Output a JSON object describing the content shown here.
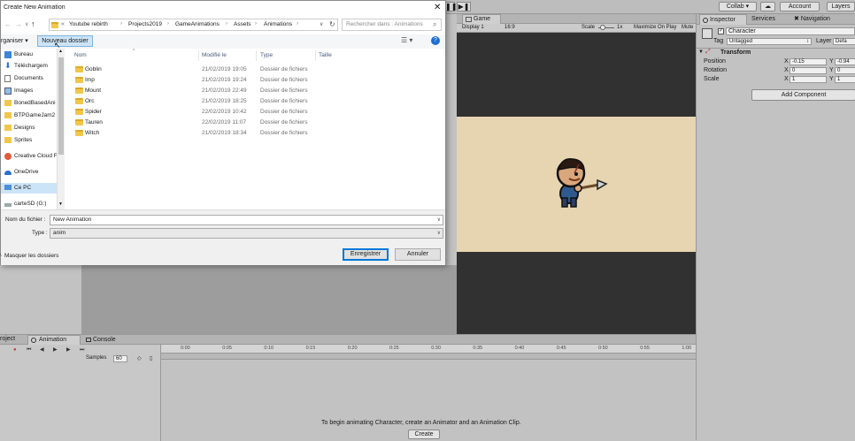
{
  "topbar": {
    "collab": "Collab ▾",
    "account": "Account",
    "layers": "Layers"
  },
  "game": {
    "tab": "Game",
    "display": "Display 1",
    "aspect": "16:9",
    "scale_label": "Scale",
    "scale_value": "1x",
    "maximize": "Maximize On Play",
    "mute": "Mute"
  },
  "inspector": {
    "tabs": [
      "Inspector",
      "Services",
      "Navigation"
    ],
    "object_name": "Character",
    "tag_label": "Tag",
    "tag_value": "Untagged",
    "layer_label": "Layer",
    "layer_value": "Defa",
    "component": "Transform",
    "position_label": "Position",
    "rotation_label": "Rotation",
    "scale_label": "Scale",
    "x_label": "X",
    "y_label": "Y",
    "pos_x": "-0.15",
    "pos_y": "-0.94",
    "rot_x": "0",
    "rot_y": "0",
    "scale_x": "1",
    "scale_y": "1",
    "add_component": "Add Component"
  },
  "animation": {
    "tab_project": "roject",
    "tab_animation": "Animation",
    "tab_console": "Console",
    "samples_label": "Samples",
    "samples_value": "60",
    "ruler": [
      "0:00",
      "0:05",
      "0:10",
      "0:15",
      "0:20",
      "0:25",
      "0:30",
      "0:35",
      "0:40",
      "0:45",
      "0:50",
      "0:55",
      "1:00"
    ],
    "message": "To begin animating Character, create an Animator and an Animation Clip.",
    "create_button": "Create"
  },
  "dialog": {
    "title": "Create New Animation",
    "close": "✕",
    "breadcrumb_prefix": "«",
    "breadcrumb": [
      "Youtube rebirth",
      "Projects2019",
      "GameAnimations",
      "Assets",
      "Animations"
    ],
    "search_placeholder": "Rechercher dans : Animations",
    "organize": "rganiser ▾",
    "new_folder": "Nouveau dossier",
    "columns": {
      "name": "Nom",
      "date": "Modifié le",
      "type": "Type",
      "size": "Taille"
    },
    "nav": [
      {
        "label": "Bureau",
        "icon": "desktop-icon"
      },
      {
        "label": "Téléchargem",
        "icon": "download-icon"
      },
      {
        "label": "Documents",
        "icon": "document-icon"
      },
      {
        "label": "Images",
        "icon": "image-icon"
      },
      {
        "label": "BonedBasedAni",
        "icon": "folder-icon"
      },
      {
        "label": "BTPGameJam2",
        "icon": "folder-icon"
      },
      {
        "label": "Designs",
        "icon": "folder-icon"
      },
      {
        "label": "Sprites",
        "icon": "folder-icon"
      },
      {
        "label": "Creative Cloud Fil",
        "icon": "cloud-icon"
      },
      {
        "label": "OneDrive",
        "icon": "cloud-icon"
      },
      {
        "label": "Ce PC",
        "icon": "computer-icon"
      },
      {
        "label": "carteSD (G:)",
        "icon": "drive-icon"
      }
    ],
    "files": [
      {
        "name": "Goblin",
        "date": "21/02/2019 19:05",
        "type": "Dossier de fichiers"
      },
      {
        "name": "Imp",
        "date": "21/02/2019 19:24",
        "type": "Dossier de fichiers"
      },
      {
        "name": "Mount",
        "date": "21/02/2019 22:49",
        "type": "Dossier de fichiers"
      },
      {
        "name": "Orc",
        "date": "21/02/2019 18:25",
        "type": "Dossier de fichiers"
      },
      {
        "name": "Spider",
        "date": "22/02/2019 10:42",
        "type": "Dossier de fichiers"
      },
      {
        "name": "Tauren",
        "date": "22/02/2019 11:07",
        "type": "Dossier de fichiers"
      },
      {
        "name": "Witch",
        "date": "21/02/2019 18:34",
        "type": "Dossier de fichiers"
      }
    ],
    "filename_label": "Nom du fichier :",
    "filename_value": "New Animation",
    "type_label": "Type :",
    "type_value": "anim",
    "hide_folders": "Masquer les dossiers",
    "save_button": "Enregistrer",
    "cancel_button": "Annuler"
  }
}
